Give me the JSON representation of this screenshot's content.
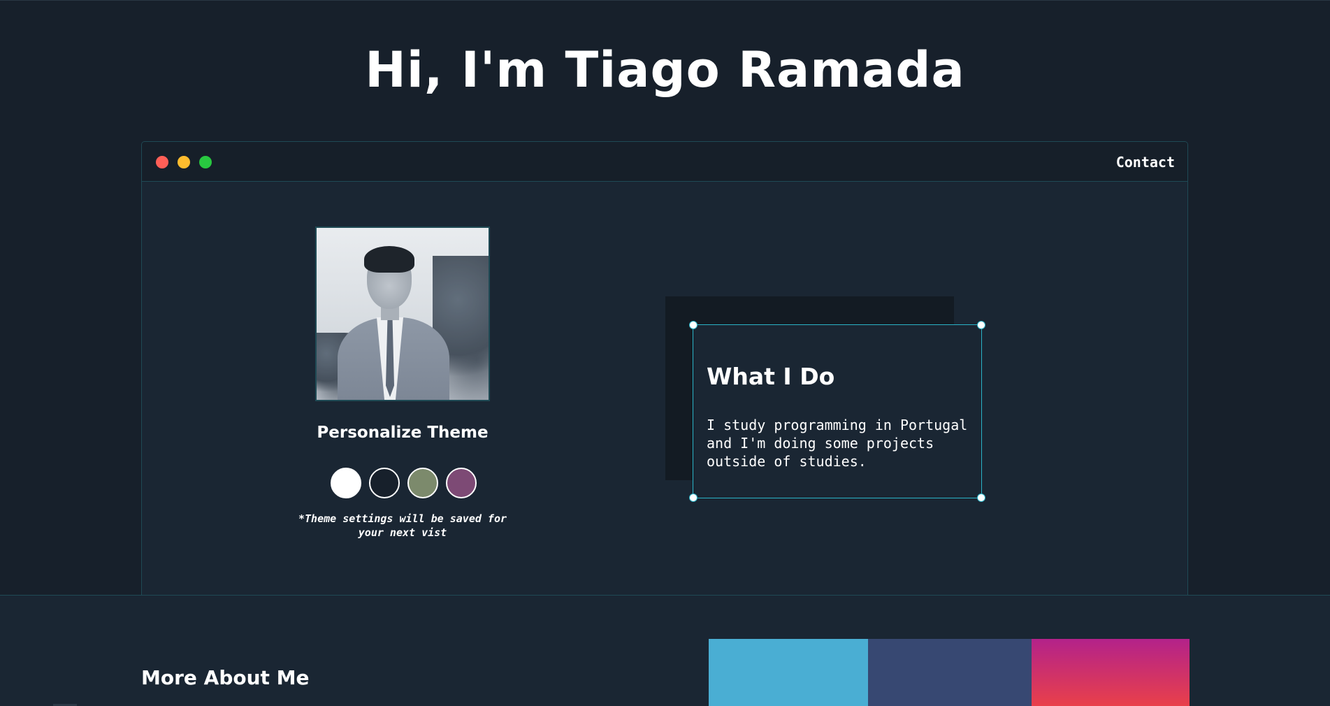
{
  "hero": {
    "title": "Hi, I'm Tiago Ramada"
  },
  "window": {
    "nav": {
      "contact_label": "Contact"
    },
    "profile": {
      "photo_alt": "Tiago Ramada profile photo"
    },
    "theme": {
      "title": "Personalize Theme",
      "note": "*Theme settings will be saved for your next vist",
      "swatches": [
        {
          "name": "white",
          "color": "#ffffff"
        },
        {
          "name": "dark",
          "color": "#17202b"
        },
        {
          "name": "olive",
          "color": "#7c8a6c"
        },
        {
          "name": "purple",
          "color": "#7d4a75"
        }
      ]
    },
    "card": {
      "title": "What I Do",
      "text": "I study programming in Portugal and I'm doing some projects outside of studies."
    }
  },
  "about": {
    "title": "More About Me",
    "colors": [
      "#4aaed3",
      "#374872",
      "#b3228a",
      "#e9404a"
    ]
  },
  "colors": {
    "background": "#17202b",
    "panel": "#1a2633",
    "accent": "#2ab3c7",
    "border": "#1f4a55"
  }
}
